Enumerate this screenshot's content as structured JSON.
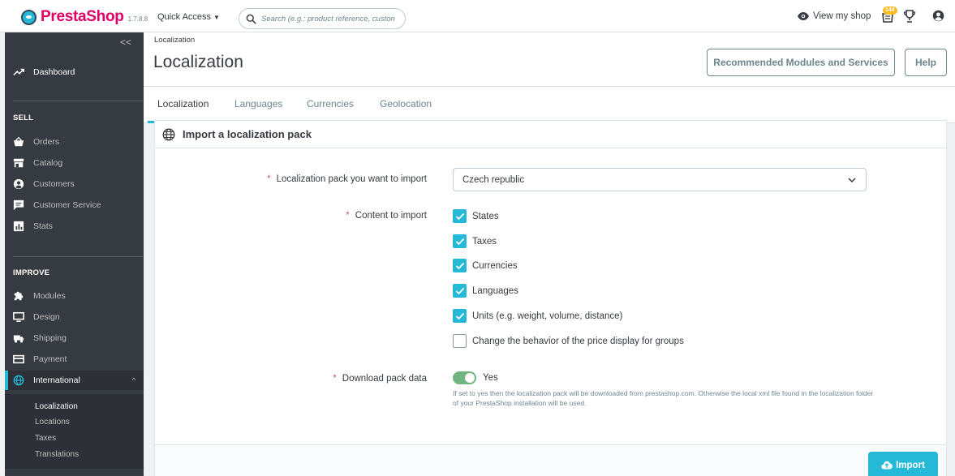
{
  "topbar": {
    "brand": "PrestaShop",
    "version": "1.7.8.8",
    "quick_access": "Quick Access",
    "search_placeholder": "Search (e.g.: product reference, custon",
    "view_shop": "View my shop",
    "notification_count": "144"
  },
  "sidebar": {
    "collapse_label": "<<",
    "dashboard": "Dashboard",
    "sections": {
      "sell": "SELL",
      "improve": "IMPROVE"
    },
    "sell_items": [
      {
        "label": "Orders",
        "icon": "basket-icon"
      },
      {
        "label": "Catalog",
        "icon": "store-icon"
      },
      {
        "label": "Customers",
        "icon": "account-icon"
      },
      {
        "label": "Customer Service",
        "icon": "chat-icon"
      },
      {
        "label": "Stats",
        "icon": "bar-chart-icon"
      }
    ],
    "improve_items": [
      {
        "label": "Modules",
        "icon": "puzzle-icon"
      },
      {
        "label": "Design",
        "icon": "desktop-icon"
      },
      {
        "label": "Shipping",
        "icon": "truck-icon"
      },
      {
        "label": "Payment",
        "icon": "credit-card-icon"
      },
      {
        "label": "International",
        "icon": "globe-icon"
      }
    ],
    "international_chevron": "^",
    "sub_items": [
      "Localization",
      "Locations",
      "Taxes",
      "Translations"
    ]
  },
  "header": {
    "breadcrumb": "Localization",
    "title": "Localization",
    "recommended_button": "Recommended Modules and Services",
    "help_button": "Help"
  },
  "tabs": [
    "Localization",
    "Languages",
    "Currencies",
    "Geolocation"
  ],
  "panel": {
    "title": "Import a localization pack",
    "pack_label": "Localization pack you want to import",
    "pack_value": "Czech republic",
    "content_label": "Content to import",
    "content_options": [
      {
        "label": "States",
        "checked": true
      },
      {
        "label": "Taxes",
        "checked": true
      },
      {
        "label": "Currencies",
        "checked": true
      },
      {
        "label": "Languages",
        "checked": true
      },
      {
        "label": "Units (e.g. weight, volume, distance)",
        "checked": true
      },
      {
        "label": "Change the behavior of the price display for groups",
        "checked": false
      }
    ],
    "download_label": "Download pack data",
    "download_value": "Yes",
    "download_help": "If set to yes then the localization pack will be downloaded from prestashop.com. Otherwise the local xml file found in the localization folder of your PrestaShop installation will be used.",
    "required_mark": "*",
    "import_button": "Import"
  },
  "colors": {
    "accent": "#25b9d7",
    "sidebar_bg": "#363a41",
    "brand_pink": "#df0067",
    "toggle_on": "#70b580"
  }
}
